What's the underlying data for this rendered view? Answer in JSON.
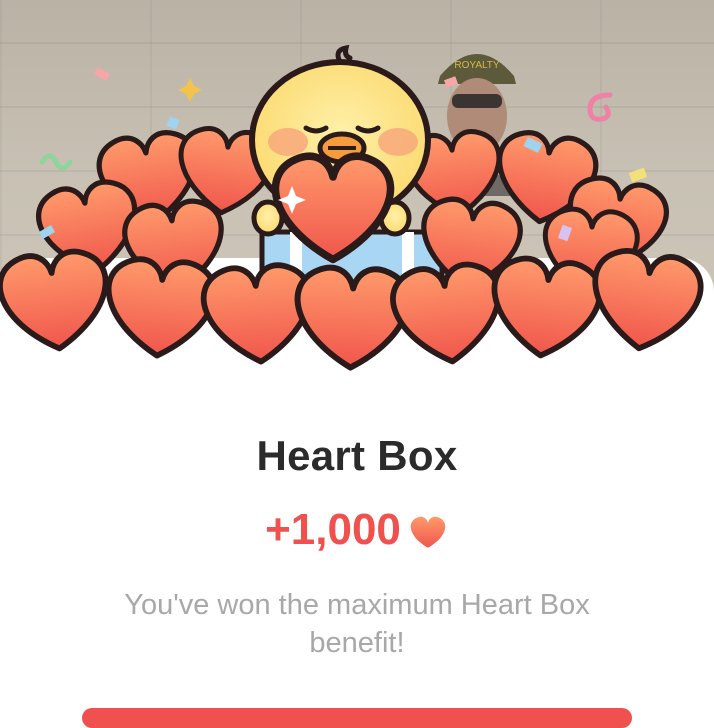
{
  "reward": {
    "title": "Heart Box",
    "amount": "+1,000",
    "icon": "heart-icon",
    "message": "You've won the maximum Heart Box benefit!"
  },
  "background": {
    "cap_text": "ROYALTY"
  },
  "colors": {
    "accent": "#f0514f",
    "heart_top": "#ff9a6b",
    "heart_bottom": "#f0564c",
    "chick": "#fde58a",
    "title": "#2b2b2b",
    "message": "#a8a8a8"
  }
}
